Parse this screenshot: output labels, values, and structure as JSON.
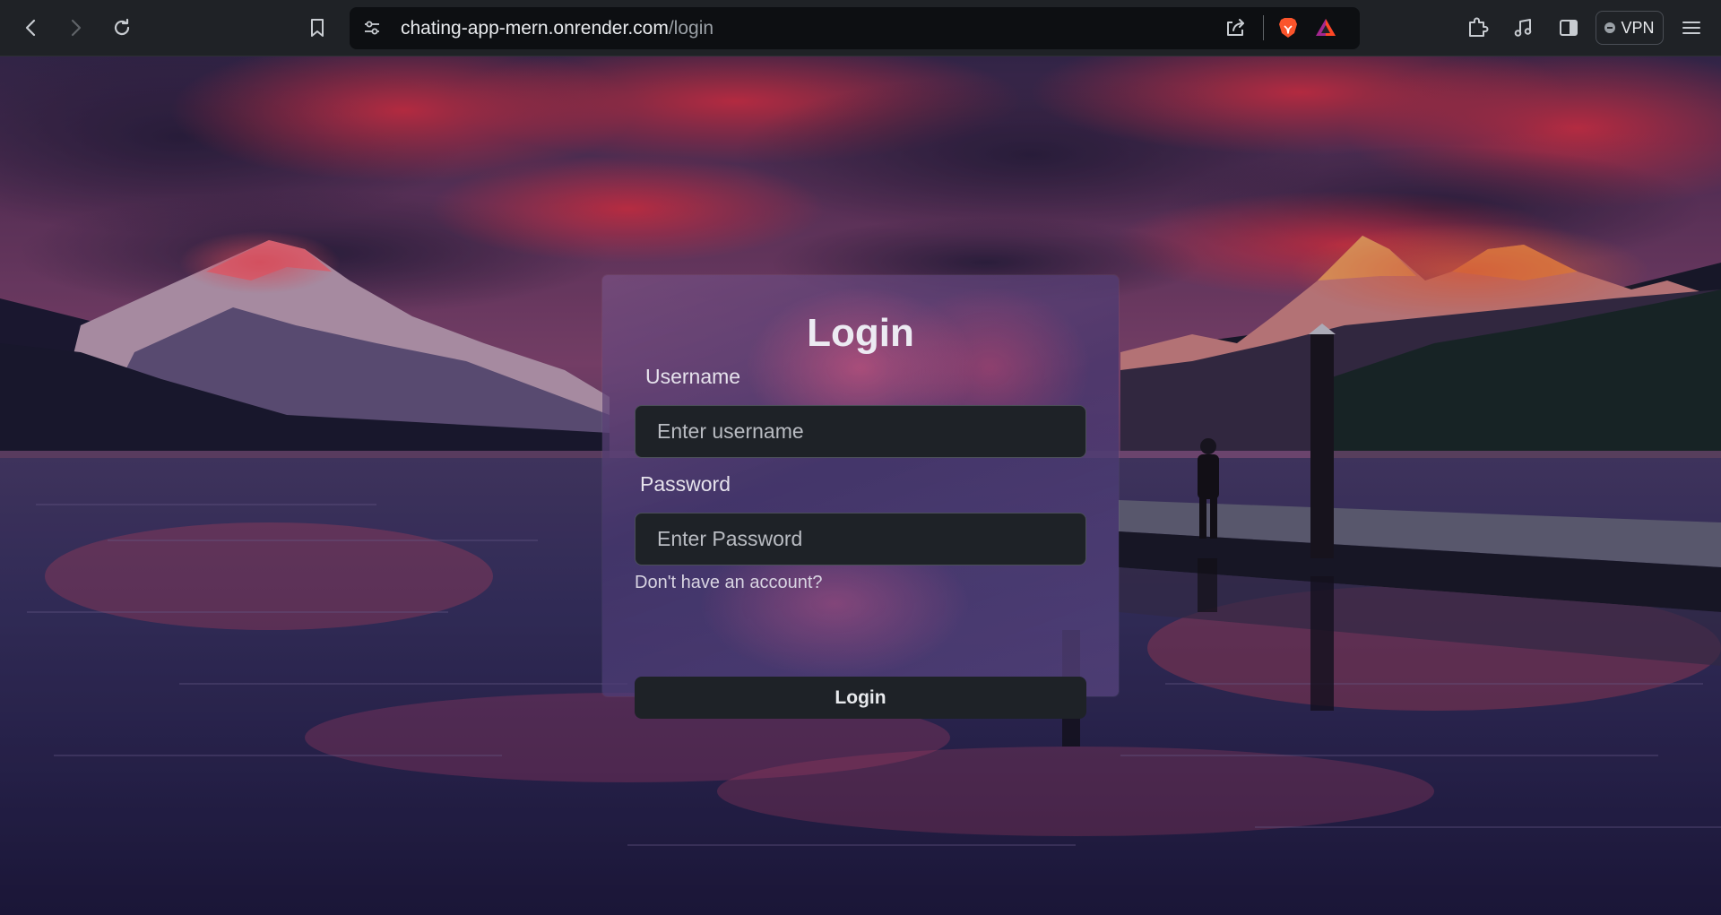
{
  "browser": {
    "url_host": "chating-app-mern.onrender.com",
    "url_path": "/login",
    "vpn_label": "VPN",
    "icons": {
      "back": "back-arrow-icon",
      "forward": "forward-arrow-icon",
      "reload": "reload-icon",
      "bookmark": "bookmark-icon",
      "site_info": "site-settings-icon",
      "share": "share-icon",
      "brave_shields": "brave-lion-icon",
      "rewards": "brave-rewards-triangle-icon",
      "extensions": "puzzle-extensions-icon",
      "media": "music-note-icon",
      "sidebar": "sidebar-toggle-icon",
      "menu": "hamburger-menu-icon"
    }
  },
  "login": {
    "title": "Login",
    "username_label": "Username",
    "username_placeholder": "Enter username",
    "password_label": "Password",
    "password_placeholder": "Enter Password",
    "signup_link": "Don't have an account?",
    "submit_label": "Login"
  },
  "colors": {
    "chrome_bg": "#1f2226",
    "urlbar_bg": "#0d0f12",
    "input_bg": "#1e2227",
    "brave_orange": "#fb542b"
  }
}
